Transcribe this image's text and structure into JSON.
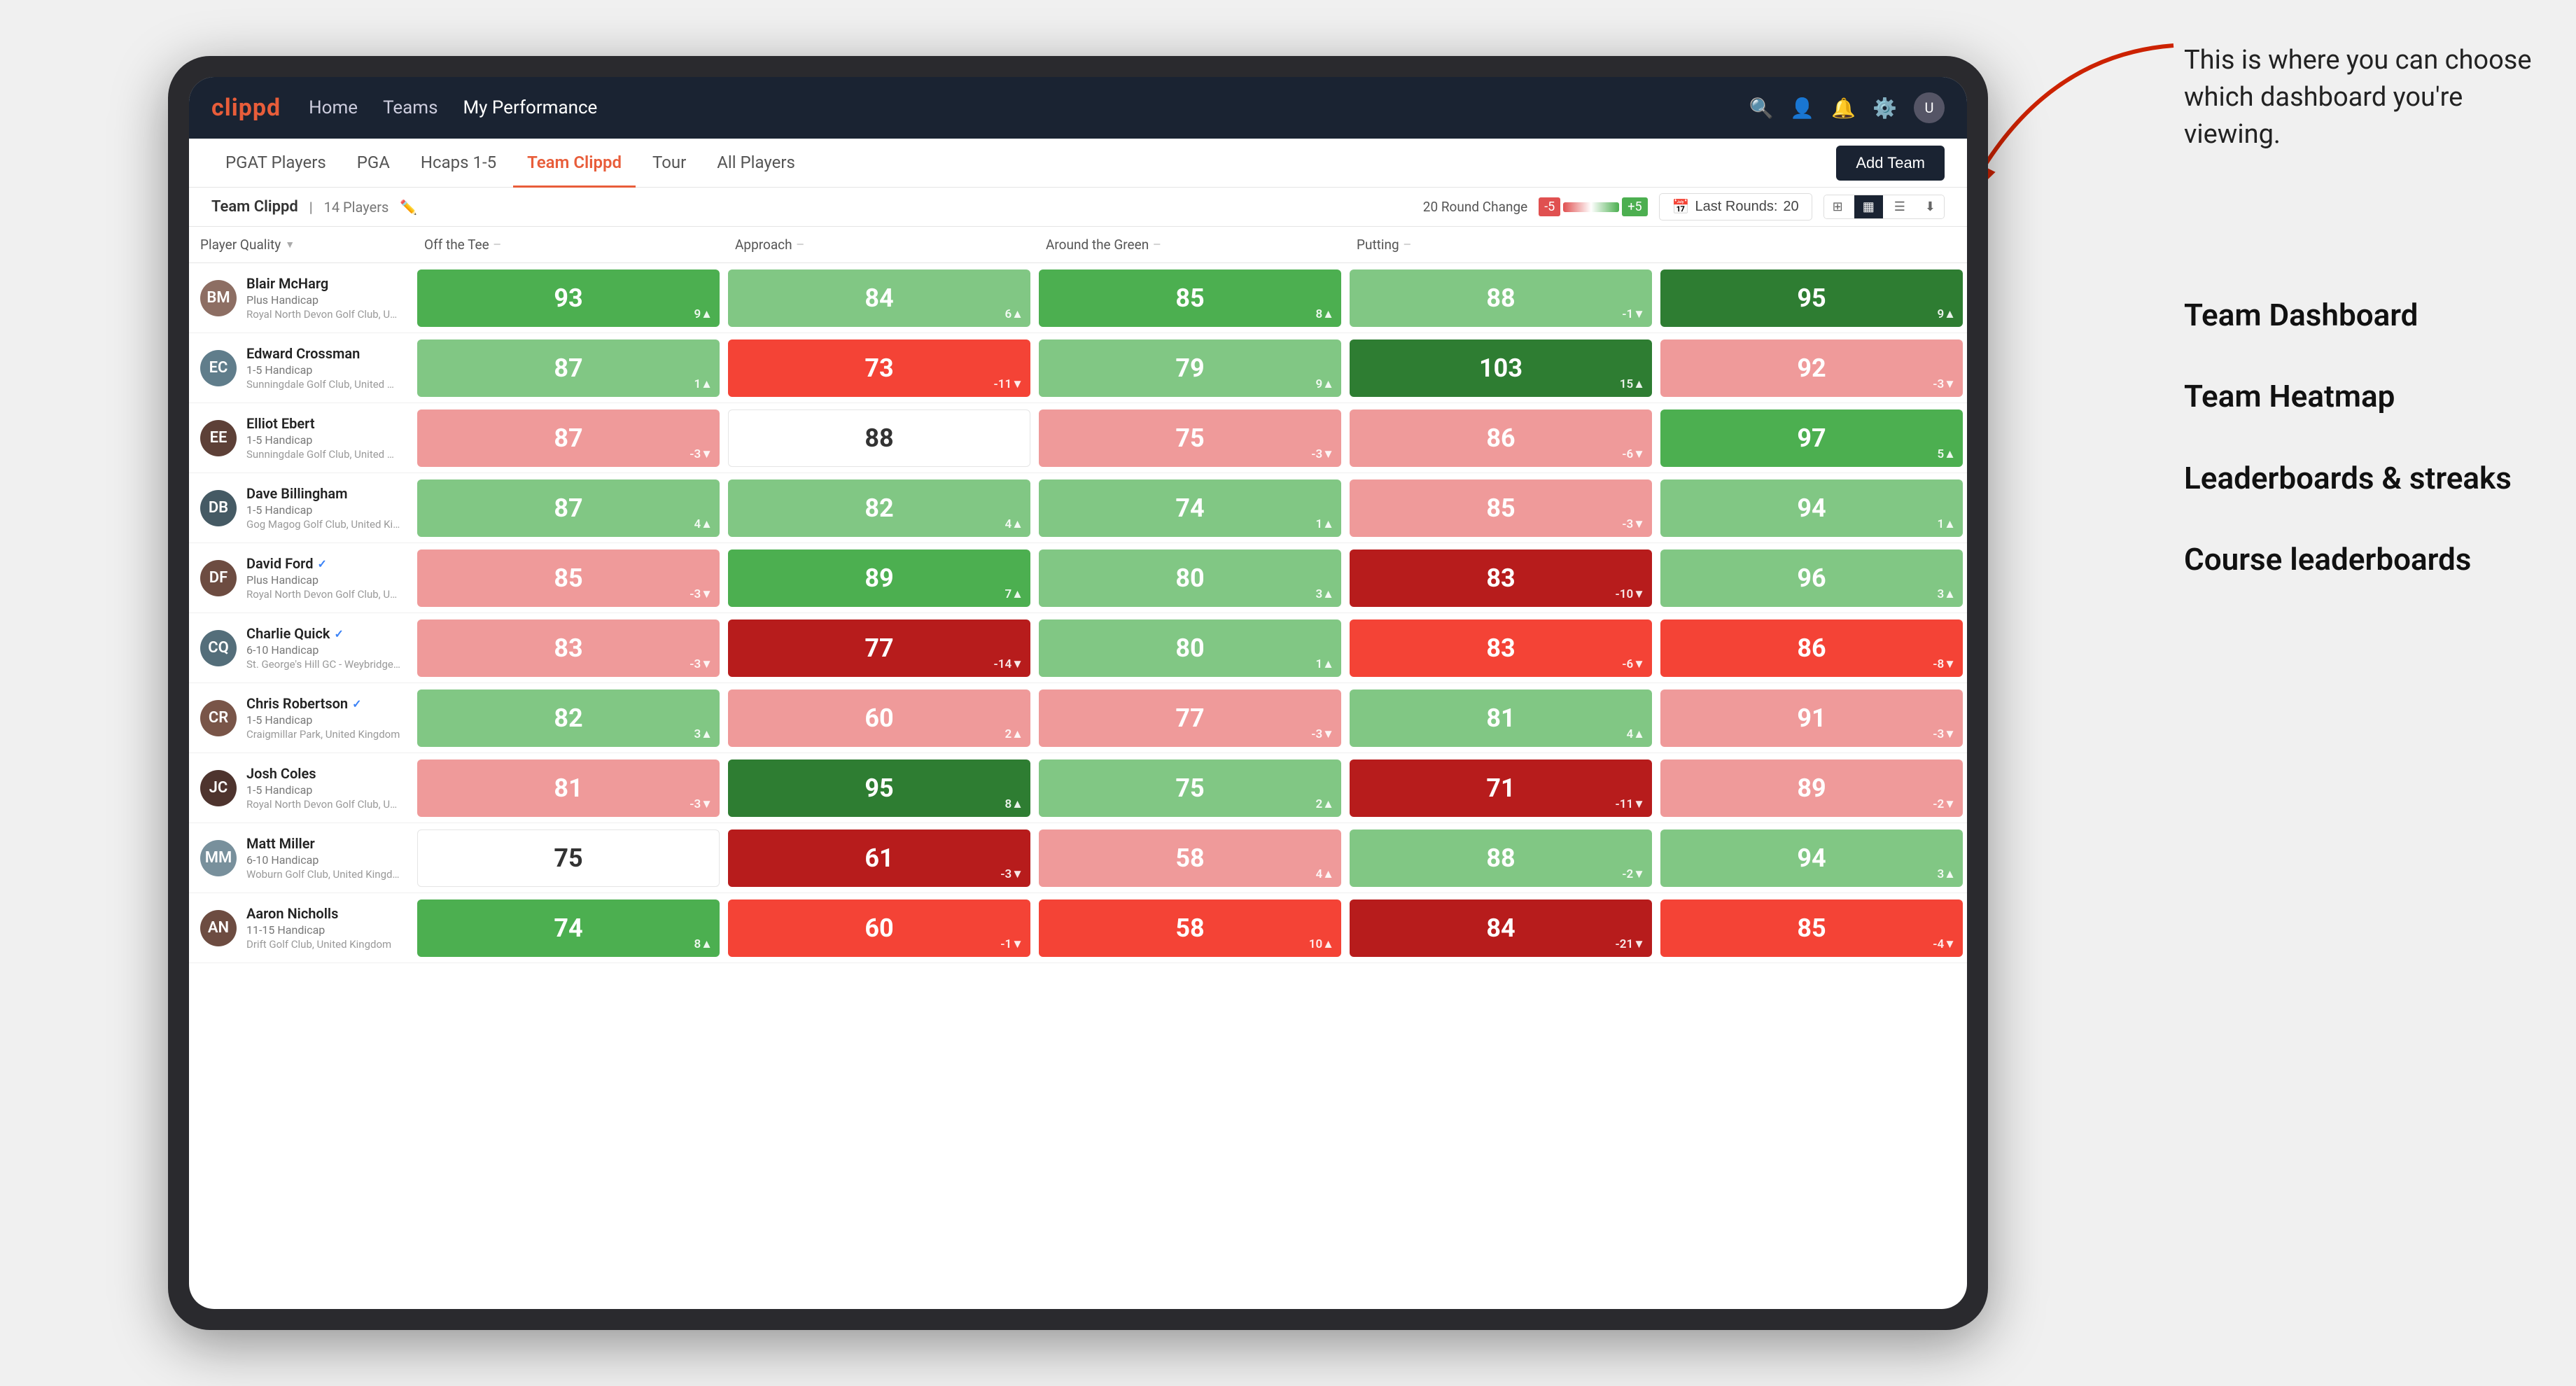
{
  "annotation": {
    "intro_text": "This is where you can choose which dashboard you're viewing.",
    "items": [
      "Team Dashboard",
      "Team Heatmap",
      "Leaderboards & streaks",
      "Course leaderboards"
    ]
  },
  "navbar": {
    "logo": "clippd",
    "links": [
      {
        "label": "Home",
        "active": false
      },
      {
        "label": "Teams",
        "active": false
      },
      {
        "label": "My Performance",
        "active": false
      }
    ],
    "icons": [
      "search",
      "person",
      "bell",
      "settings",
      "avatar"
    ]
  },
  "tabs": {
    "items": [
      {
        "label": "PGAT Players",
        "active": false
      },
      {
        "label": "PGA",
        "active": false
      },
      {
        "label": "Hcaps 1-5",
        "active": false
      },
      {
        "label": "Team Clippd",
        "active": true
      },
      {
        "label": "Tour",
        "active": false
      },
      {
        "label": "All Players",
        "active": false
      }
    ],
    "add_team_label": "Add Team"
  },
  "team_bar": {
    "team_name": "Team Clippd",
    "separator": "|",
    "player_count": "14 Players",
    "round_change_label": "20 Round Change",
    "badge_low": "-5",
    "badge_high": "+5",
    "last_rounds_label": "Last Rounds:",
    "last_rounds_value": "20"
  },
  "col_headers": {
    "player": "Player Quality",
    "tee": "Off the Tee",
    "approach": "Approach",
    "around_green": "Around the Green",
    "putting": "Putting"
  },
  "players": [
    {
      "name": "Blair McHarg",
      "handicap": "Plus Handicap",
      "club": "Royal North Devon Golf Club, United Kingdom",
      "avatar_initials": "BM",
      "avatar_class": "av-1",
      "scores": [
        {
          "value": "93",
          "change": "9▲",
          "color_class": "green-medium"
        },
        {
          "value": "84",
          "change": "6▲",
          "color_class": "green-light"
        },
        {
          "value": "85",
          "change": "8▲",
          "color_class": "green-medium"
        },
        {
          "value": "88",
          "change": "-1▼",
          "color_class": "green-light"
        },
        {
          "value": "95",
          "change": "9▲",
          "color_class": "green-dark"
        }
      ]
    },
    {
      "name": "Edward Crossman",
      "handicap": "1-5 Handicap",
      "club": "Sunningdale Golf Club, United Kingdom",
      "avatar_initials": "EC",
      "avatar_class": "av-2",
      "scores": [
        {
          "value": "87",
          "change": "1▲",
          "color_class": "green-light"
        },
        {
          "value": "73",
          "change": "-11▼",
          "color_class": "red-medium"
        },
        {
          "value": "79",
          "change": "9▲",
          "color_class": "green-light"
        },
        {
          "value": "103",
          "change": "15▲",
          "color_class": "green-dark"
        },
        {
          "value": "92",
          "change": "-3▼",
          "color_class": "red-light"
        }
      ]
    },
    {
      "name": "Elliot Ebert",
      "handicap": "1-5 Handicap",
      "club": "Sunningdale Golf Club, United Kingdom",
      "avatar_initials": "EE",
      "avatar_class": "av-3",
      "scores": [
        {
          "value": "87",
          "change": "-3▼",
          "color_class": "red-light"
        },
        {
          "value": "88",
          "change": "",
          "color_class": "white"
        },
        {
          "value": "75",
          "change": "-3▼",
          "color_class": "red-light"
        },
        {
          "value": "86",
          "change": "-6▼",
          "color_class": "red-light"
        },
        {
          "value": "97",
          "change": "5▲",
          "color_class": "green-medium"
        }
      ]
    },
    {
      "name": "Dave Billingham",
      "handicap": "1-5 Handicap",
      "club": "Gog Magog Golf Club, United Kingdom",
      "avatar_initials": "DB",
      "avatar_class": "av-4",
      "scores": [
        {
          "value": "87",
          "change": "4▲",
          "color_class": "green-light"
        },
        {
          "value": "82",
          "change": "4▲",
          "color_class": "green-light"
        },
        {
          "value": "74",
          "change": "1▲",
          "color_class": "green-light"
        },
        {
          "value": "85",
          "change": "-3▼",
          "color_class": "red-light"
        },
        {
          "value": "94",
          "change": "1▲",
          "color_class": "green-light"
        }
      ]
    },
    {
      "name": "David Ford",
      "handicap": "Plus Handicap",
      "club": "Royal North Devon Golf Club, United Kingdom",
      "avatar_initials": "DF",
      "avatar_class": "av-5",
      "verified": true,
      "scores": [
        {
          "value": "85",
          "change": "-3▼",
          "color_class": "red-light"
        },
        {
          "value": "89",
          "change": "7▲",
          "color_class": "green-medium"
        },
        {
          "value": "80",
          "change": "3▲",
          "color_class": "green-light"
        },
        {
          "value": "83",
          "change": "-10▼",
          "color_class": "red-dark"
        },
        {
          "value": "96",
          "change": "3▲",
          "color_class": "green-light"
        }
      ]
    },
    {
      "name": "Charlie Quick",
      "handicap": "6-10 Handicap",
      "club": "St. George's Hill GC - Weybridge - Surrey, Uni...",
      "avatar_initials": "CQ",
      "avatar_class": "av-6",
      "verified": true,
      "scores": [
        {
          "value": "83",
          "change": "-3▼",
          "color_class": "red-light"
        },
        {
          "value": "77",
          "change": "-14▼",
          "color_class": "red-dark"
        },
        {
          "value": "80",
          "change": "1▲",
          "color_class": "green-light"
        },
        {
          "value": "83",
          "change": "-6▼",
          "color_class": "red-medium"
        },
        {
          "value": "86",
          "change": "-8▼",
          "color_class": "red-medium"
        }
      ]
    },
    {
      "name": "Chris Robertson",
      "handicap": "1-5 Handicap",
      "club": "Craigmillar Park, United Kingdom",
      "avatar_initials": "CR",
      "avatar_class": "av-7",
      "verified": true,
      "scores": [
        {
          "value": "82",
          "change": "3▲",
          "color_class": "green-light"
        },
        {
          "value": "60",
          "change": "2▲",
          "color_class": "red-light"
        },
        {
          "value": "77",
          "change": "-3▼",
          "color_class": "red-light"
        },
        {
          "value": "81",
          "change": "4▲",
          "color_class": "green-light"
        },
        {
          "value": "91",
          "change": "-3▼",
          "color_class": "red-light"
        }
      ]
    },
    {
      "name": "Josh Coles",
      "handicap": "1-5 Handicap",
      "club": "Royal North Devon Golf Club, United Kingdom",
      "avatar_initials": "JC",
      "avatar_class": "av-8",
      "scores": [
        {
          "value": "81",
          "change": "-3▼",
          "color_class": "red-light"
        },
        {
          "value": "95",
          "change": "8▲",
          "color_class": "green-dark"
        },
        {
          "value": "75",
          "change": "2▲",
          "color_class": "green-light"
        },
        {
          "value": "71",
          "change": "-11▼",
          "color_class": "red-dark"
        },
        {
          "value": "89",
          "change": "-2▼",
          "color_class": "red-light"
        }
      ]
    },
    {
      "name": "Matt Miller",
      "handicap": "6-10 Handicap",
      "club": "Woburn Golf Club, United Kingdom",
      "avatar_initials": "MM",
      "avatar_class": "av-9",
      "scores": [
        {
          "value": "75",
          "change": "",
          "color_class": "white"
        },
        {
          "value": "61",
          "change": "-3▼",
          "color_class": "red-dark"
        },
        {
          "value": "58",
          "change": "4▲",
          "color_class": "red-light"
        },
        {
          "value": "88",
          "change": "-2▼",
          "color_class": "green-light"
        },
        {
          "value": "94",
          "change": "3▲",
          "color_class": "green-light"
        }
      ]
    },
    {
      "name": "Aaron Nicholls",
      "handicap": "11-15 Handicap",
      "club": "Drift Golf Club, United Kingdom",
      "avatar_initials": "AN",
      "avatar_class": "av-10",
      "scores": [
        {
          "value": "74",
          "change": "8▲",
          "color_class": "green-medium"
        },
        {
          "value": "60",
          "change": "-1▼",
          "color_class": "red-medium"
        },
        {
          "value": "58",
          "change": "10▲",
          "color_class": "red-medium"
        },
        {
          "value": "84",
          "change": "-21▼",
          "color_class": "red-dark"
        },
        {
          "value": "85",
          "change": "-4▼",
          "color_class": "red-medium"
        }
      ]
    }
  ]
}
